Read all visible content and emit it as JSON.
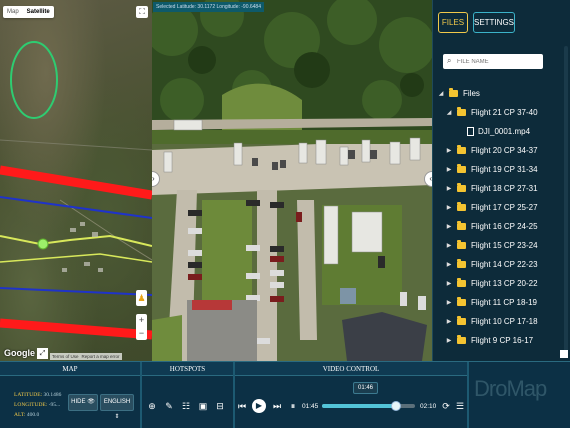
{
  "map": {
    "tabs": [
      {
        "label": "Map"
      },
      {
        "label": "Satellite"
      }
    ],
    "google_logo": "Google",
    "credits": [
      "Terms of Use",
      "Report a map error"
    ]
  },
  "video": {
    "selected_coords": "Selected Latitude: 30.1172 Longitude: -90.6484"
  },
  "files_panel": {
    "files_tab": "FILES",
    "settings_tab": "SETTINGS",
    "search_placeholder": "FILE NAME",
    "root": "Files",
    "items": [
      {
        "label": "Flight 21 CP 37-40",
        "expanded": true
      },
      {
        "label": "DJI_0001.mp4",
        "type": "file"
      },
      {
        "label": "Flight 20 CP 34-37"
      },
      {
        "label": "Flight 19 CP 31-34"
      },
      {
        "label": "Flight 18 CP 27-31"
      },
      {
        "label": "Flight 17 CP 25-27"
      },
      {
        "label": "Flight 16 CP 24-25"
      },
      {
        "label": "Flight 15 CP 23-24"
      },
      {
        "label": "Flight 14 CP 22-23"
      },
      {
        "label": "Flight 13 CP 20-22"
      },
      {
        "label": "Flight 11 CP 18-19"
      },
      {
        "label": "Flight 10 CP 17-18"
      },
      {
        "label": "Flight 9 CP 16-17"
      }
    ]
  },
  "controls": {
    "map_title": "MAP",
    "hotspots_title": "HOTSPOTS",
    "video_title": "VIDEO CONTROL",
    "latitude_label": "LATITUDE:",
    "latitude_value": "30.1486",
    "longitude_label": "LONGITUDE:",
    "longitude_value": "-95...",
    "alt_label": "ALT:",
    "alt_value": "400.0",
    "hide_label": "HIDE",
    "language_label": "ENGLISH",
    "current_time": "01:45",
    "tooltip_time": "01:46",
    "total_time": "02:10",
    "progress": 0.8,
    "brand": "DroMap"
  }
}
